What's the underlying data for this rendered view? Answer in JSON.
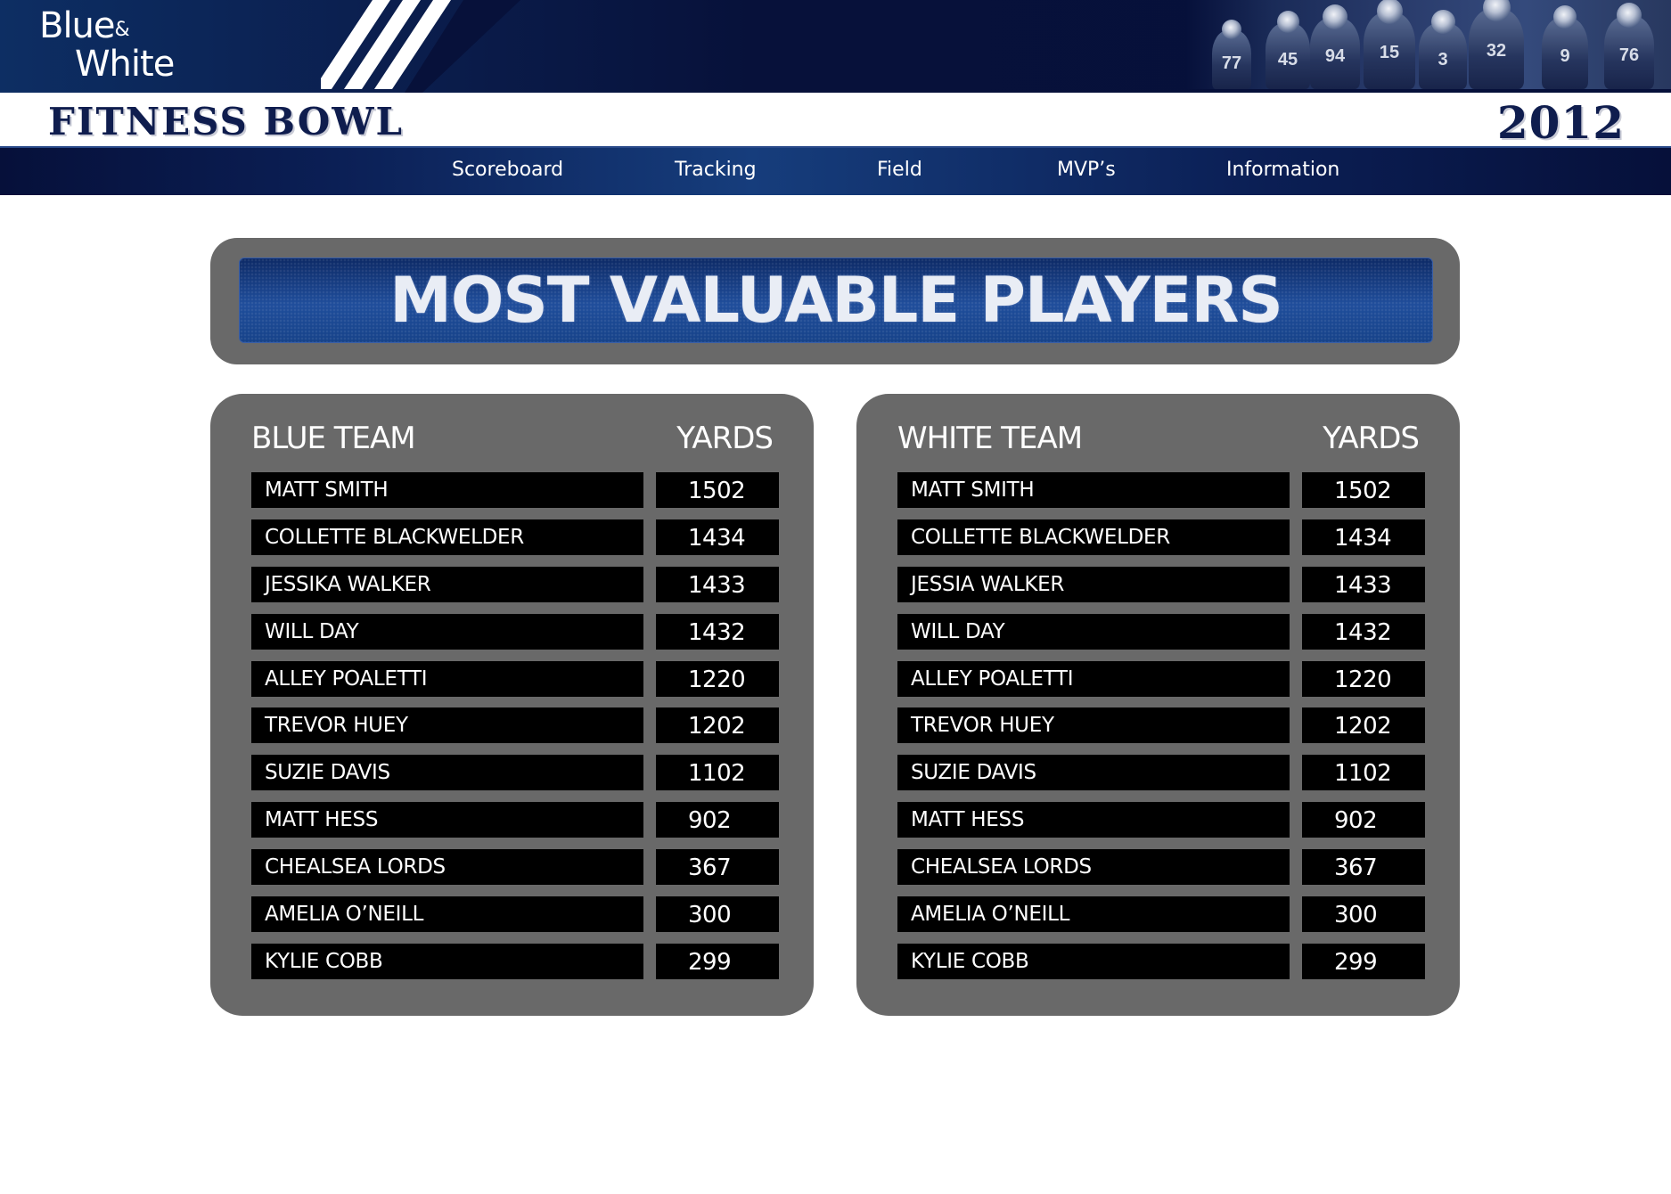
{
  "header": {
    "logo_line1": "Blue",
    "logo_amp": "&",
    "logo_line2": "White",
    "event_title": "FITNESS BOWL",
    "year": "2012",
    "team_photo_numbers": [
      "77",
      "45",
      "94",
      "15",
      "3",
      "32",
      "9",
      "76"
    ]
  },
  "nav": {
    "items": [
      {
        "label": "Scoreboard"
      },
      {
        "label": "Tracking"
      },
      {
        "label": "Field"
      },
      {
        "label": "MVP’s"
      },
      {
        "label": "Information"
      }
    ]
  },
  "page": {
    "title": "MOST VALUABLE PLAYERS"
  },
  "teams": {
    "blue": {
      "name": "BLUE TEAM",
      "column_header": "YARDS",
      "players": [
        {
          "name": "MATT SMITH",
          "yards": "1502"
        },
        {
          "name": "COLLETTE BLACKWELDER",
          "yards": "1434"
        },
        {
          "name": "JESSIKA WALKER",
          "yards": "1433"
        },
        {
          "name": "WILL DAY",
          "yards": "1432"
        },
        {
          "name": "ALLEY POALETTI",
          "yards": "1220"
        },
        {
          "name": "TREVOR HUEY",
          "yards": "1202"
        },
        {
          "name": "SUZIE DAVIS",
          "yards": "1102"
        },
        {
          "name": "MATT HESS",
          "yards": "902"
        },
        {
          "name": "CHEALSEA LORDS",
          "yards": "367"
        },
        {
          "name": "AMELIA O’NEILL",
          "yards": "300"
        },
        {
          "name": "KYLIE COBB",
          "yards": "299"
        }
      ]
    },
    "white": {
      "name": "WHITE TEAM",
      "column_header": "YARDS",
      "players": [
        {
          "name": "MATT SMITH",
          "yards": "1502"
        },
        {
          "name": "COLLETTE BLACKWELDER",
          "yards": "1434"
        },
        {
          "name": "JESSIA WALKER",
          "yards": "1433"
        },
        {
          "name": "WILL DAY",
          "yards": "1432"
        },
        {
          "name": "ALLEY POALETTI",
          "yards": "1220"
        },
        {
          "name": "TREVOR HUEY",
          "yards": "1202"
        },
        {
          "name": "SUZIE DAVIS",
          "yards": "1102"
        },
        {
          "name": "MATT HESS",
          "yards": "902"
        },
        {
          "name": "CHEALSEA LORDS",
          "yards": "367"
        },
        {
          "name": "AMELIA O’NEILL",
          "yards": "300"
        },
        {
          "name": "KYLIE COBB",
          "yards": "299"
        }
      ]
    }
  },
  "colors": {
    "banner_navy": "#06103a",
    "panel_gray": "#696969",
    "row_black": "#000000",
    "title_navy": "#0f1d4e",
    "accent_blue": "#1f4d9b"
  }
}
